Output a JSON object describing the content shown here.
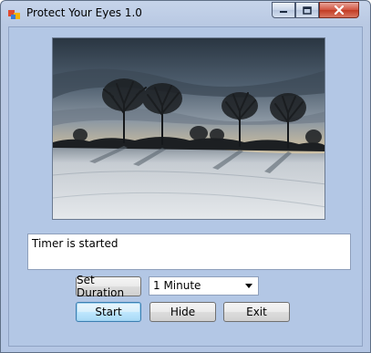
{
  "window": {
    "title": "Protect Your Eyes 1.0",
    "controls": {
      "minimize": "minimize-icon",
      "maximize": "maximize-icon",
      "close": "close-icon"
    }
  },
  "main": {
    "image": "winter-trees-landscape",
    "status_text": "Timer is started",
    "set_duration_label": "Set Duration",
    "duration_selected": "1 Minute",
    "start_label": "Start",
    "hide_label": "Hide",
    "exit_label": "Exit"
  },
  "colors": {
    "window_bg": "#b3c7e5",
    "close_button": "#c23b23",
    "start_button_border": "#3c7fb1"
  }
}
